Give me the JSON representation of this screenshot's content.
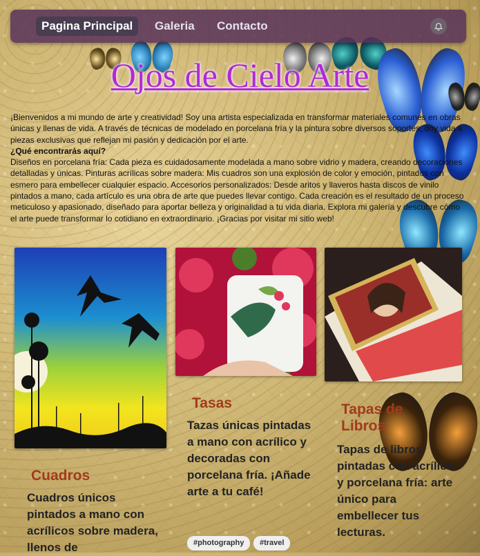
{
  "nav": {
    "items": [
      {
        "label": "Pagina Principal",
        "active": true
      },
      {
        "label": "Galeria",
        "active": false
      },
      {
        "label": "Contacto",
        "active": false
      }
    ],
    "bell_icon": "bell-icon"
  },
  "hero": {
    "title": "Ojos de Cielo Arte"
  },
  "intro": {
    "p1": "¡Bienvenidos a mi mundo de arte y creatividad! Soy una artista especializada en transformar materiales comunes en obras únicas y llenas de vida. A través de técnicas de modelado en porcelana fría y la pintura sobre diversos soportes, doy vida a piezas exclusivas que reflejan mi pasión y dedicación por el arte.",
    "heading": "¿Qué encontrarás aquí?",
    "p2": "Diseños en porcelana fría: Cada pieza es cuidadosamente modelada a mano sobre vidrio y madera, creando decoraciones detalladas y únicas. Pinturas acrílicas sobre madera: Mis cuadros son una explosión de color y emoción, pintados con esmero para embellecer cualquier espacio. Accesorios personalizados: Desde aritos y llaveros hasta discos de vinilo pintados a mano, cada artículo es una obra de arte que puedes llevar contigo. Cada creación es el resultado de un proceso meticuloso y apasionado, diseñado para aportar belleza y originalidad a tu vida diaria. Explora mi galería y descubre cómo el arte puede transformar lo cotidiano en extraordinario. ¡Gracias por visitar mi sitio web!"
  },
  "cards": [
    {
      "title": "Cuadros",
      "desc": "Cuadros únicos pintados a mano con acrílicos sobre madera, llenos de"
    },
    {
      "title": "Tasas",
      "desc": "Tazas únicas pintadas a mano con acrílico y decoradas con porcelana fría. ¡Añade arte a tu café!"
    },
    {
      "title": "Tapas de Libros",
      "desc": "Tapas de libros pintadas con acrílico y porcelana fría: arte único para embellecer tus lecturas."
    }
  ],
  "tags": [
    "#photography",
    "#travel"
  ],
  "colors": {
    "title": "#b12ad6",
    "card_title": "#a23a1c",
    "nav_bg": "#58325a"
  }
}
